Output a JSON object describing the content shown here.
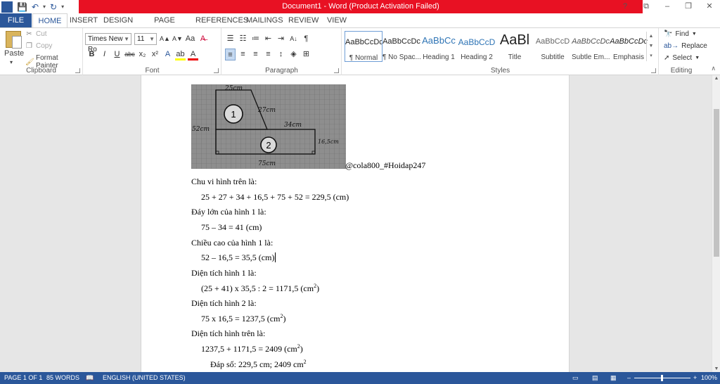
{
  "window": {
    "title": "Document1 - Word (Product Activation Failed)",
    "help": "?",
    "ribbon_opts": "⧉",
    "minimize": "–",
    "restore": "❐",
    "close": "✕"
  },
  "qat": {
    "save": "💾",
    "undo": "↶",
    "undo_dd": "▾",
    "redo": "↻",
    "customize": "▾"
  },
  "tabs": [
    "FILE",
    "HOME",
    "INSERT",
    "DESIGN",
    "PAGE LAYOUT",
    "REFERENCES",
    "MAILINGS",
    "REVIEW",
    "VIEW"
  ],
  "clipboard": {
    "paste": "Paste",
    "paste_dd": "▾",
    "cut": "Cut",
    "copy": "Copy",
    "format_painter": "Format Painter",
    "label": "Clipboard"
  },
  "font": {
    "name": "Times New Ro",
    "size": "11",
    "label": "Font",
    "grow": "A▲",
    "shrink": "A▼",
    "case": "Aa",
    "clear": "A̶",
    "bold": "B",
    "italic": "I",
    "underline": "U",
    "strike": "abc",
    "sub": "x₂",
    "sup": "x²",
    "effects": "A",
    "highlight": "ab",
    "color": "A"
  },
  "paragraph": {
    "label": "Paragraph",
    "bullets": "☰",
    "numbering": "☷",
    "multilevel": "≔",
    "dec_indent": "⇤",
    "inc_indent": "⇥",
    "sort": "A↓",
    "pilcrow": "¶",
    "align_left": "≡",
    "center": "≡",
    "align_right": "≡",
    "justify": "≡",
    "spacing": "↕",
    "shading": "◈",
    "borders": "⊞"
  },
  "styles": {
    "label": "Styles",
    "items": [
      {
        "preview": "AaBbCcDc",
        "name": "¶ Normal"
      },
      {
        "preview": "AaBbCcDc",
        "name": "¶ No Spac..."
      },
      {
        "preview": "AaBbCc",
        "name": "Heading 1"
      },
      {
        "preview": "AaBbCcD",
        "name": "Heading 2"
      },
      {
        "preview": "AaBl",
        "name": "Title"
      },
      {
        "preview": "AaBbCcD",
        "name": "Subtitle"
      },
      {
        "preview": "AaBbCcDc",
        "name": "Subtle Em..."
      },
      {
        "preview": "AaBbCcDc",
        "name": "Emphasis"
      }
    ],
    "scroll_up": "▲",
    "scroll_down": "▼",
    "more": "▾"
  },
  "editing": {
    "label": "Editing",
    "find": "Find",
    "replace": "Replace",
    "select": "Select"
  },
  "document": {
    "figure": {
      "top_label": "25cm",
      "slant_label": "27cm",
      "left_label": "52cm",
      "mid_label": "34cm",
      "right_label": "16,5cm",
      "bottom_label": "75cm",
      "shape1": "1",
      "shape2": "2"
    },
    "caption": "@cola800_#Hoidap247",
    "lines": [
      "Chu vi hình trên là:",
      "25 + 27 + 34 + 16,5 + 75 + 52 = 229,5 (cm)",
      "Đáy lớn của hình 1 là:",
      "75 – 34 = 41 (cm)",
      "Chiều cao của hình 1 là:",
      "52 – 16,5 = 35,5 (cm)",
      "Diện tích hình 1 là:",
      "(25 + 41) x 35,5 : 2 = 1171,5 (cm",
      "Diện tích hình 2 là:",
      "75 x 16,5 = 1237,5 (cm",
      "Diện tích hình trên là:",
      "1237,5 + 1171,5 = 2409 (cm",
      "Đáp số: 229,5 cm; 2409 cm"
    ],
    "sup2": "2",
    "close_paren": ")"
  },
  "status": {
    "page": "PAGE 1 OF 1",
    "words": "85 WORDS",
    "language": "ENGLISH (UNITED STATES)",
    "zoom": "100%",
    "zoom_out": "–",
    "zoom_in": "+"
  },
  "colors": {
    "word_blue": "#2b579a",
    "title_red": "#e81123"
  }
}
